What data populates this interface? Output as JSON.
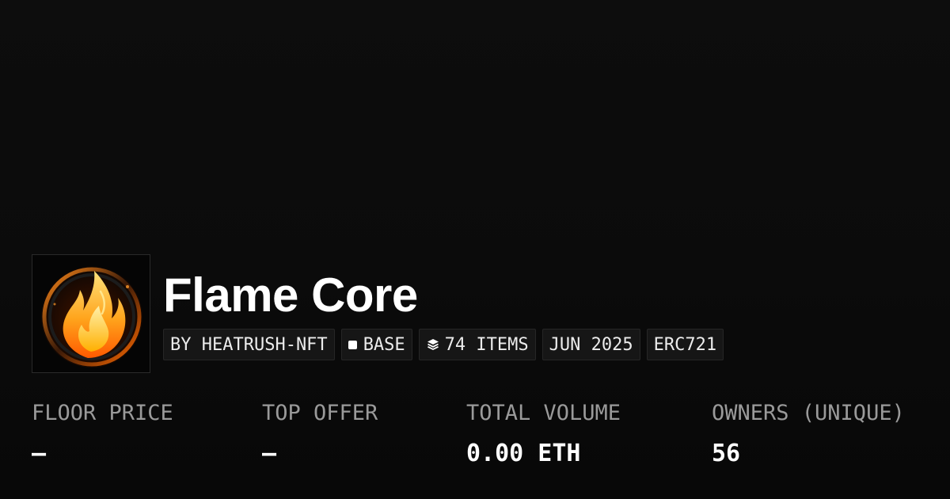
{
  "collection": {
    "name": "Flame Core",
    "avatar_icon": "flame-icon"
  },
  "tags": {
    "creator": "BY HEATRUSH-NFT",
    "chain": "BASE",
    "items": "74 ITEMS",
    "created": "JUN 2025",
    "standard": "ERC721"
  },
  "stats": [
    {
      "label": "FLOOR PRICE",
      "value": "–"
    },
    {
      "label": "TOP OFFER",
      "value": "–"
    },
    {
      "label": "TOTAL VOLUME",
      "value": "0.00 ETH"
    },
    {
      "label": "OWNERS (UNIQUE)",
      "value": "56"
    }
  ],
  "colors": {
    "background": "#0b0b0b",
    "tag_background": "#161616",
    "label": "#9a9a9a",
    "text": "#ffffff",
    "flame": "#ffb020"
  }
}
